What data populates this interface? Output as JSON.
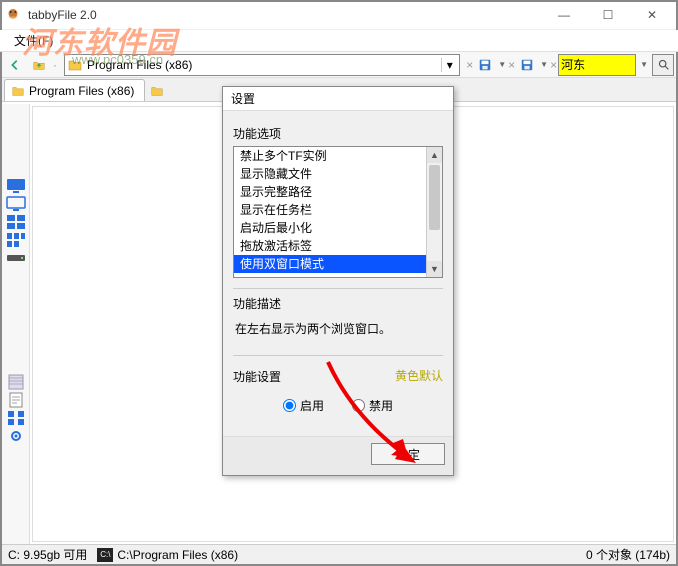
{
  "window": {
    "title": "tabbyFile 2.0",
    "min": "—",
    "max": "☐",
    "close": "✕"
  },
  "menu": {
    "file": "文件(F)"
  },
  "watermark": {
    "main": "河东软件园",
    "sub": "www.pc0359.cn"
  },
  "toolbar": {
    "path": "Program Files (x86)",
    "search_value": "河东",
    "x": "×",
    "dd": "▾"
  },
  "tabs": {
    "main": "Program Files (x86)",
    "add": "+"
  },
  "dialog": {
    "title": "设置",
    "group_options": "功能选项",
    "options": [
      "禁止多个TF实例",
      "显示隐藏文件",
      "显示完整路径",
      "显示在任务栏",
      "启动后最小化",
      "拖放激活标签",
      "使用双窗口模式"
    ],
    "selected_index": 6,
    "group_desc": "功能描述",
    "desc_text": "在左右显示为两个浏览窗口。",
    "group_setting": "功能设置",
    "yellow_default": "黄色默认",
    "radio_enable": "启用",
    "radio_disable": "禁用",
    "ok": "确定"
  },
  "status": {
    "disk": "C: 9.95gb 可用",
    "path": "C:\\Program Files (x86)",
    "objects": "0 个对象  (174b)"
  }
}
